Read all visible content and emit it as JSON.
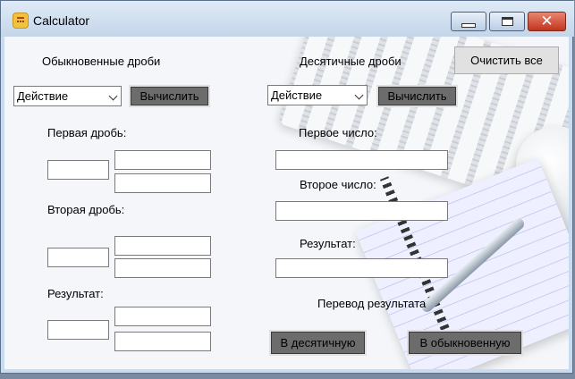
{
  "window": {
    "title": "Calculator"
  },
  "left": {
    "heading": "Обыкновенные дроби",
    "action_select": "Действие",
    "calc_button": "Вычислить",
    "first_fraction_label": "Первая дробь:",
    "second_fraction_label": "Вторая дробь:",
    "result_label": "Результат:"
  },
  "right": {
    "heading": "Десятичные дроби",
    "clear_button": "Очистить все",
    "action_select": "Действие",
    "calc_button": "Вычислить",
    "first_number_label": "Первое число:",
    "second_number_label": "Второе число:",
    "result_label": "Результат:",
    "convert_label": "Перевод результата",
    "to_decimal_button": "В десятичную",
    "to_fraction_button": "В обыкновенную"
  }
}
